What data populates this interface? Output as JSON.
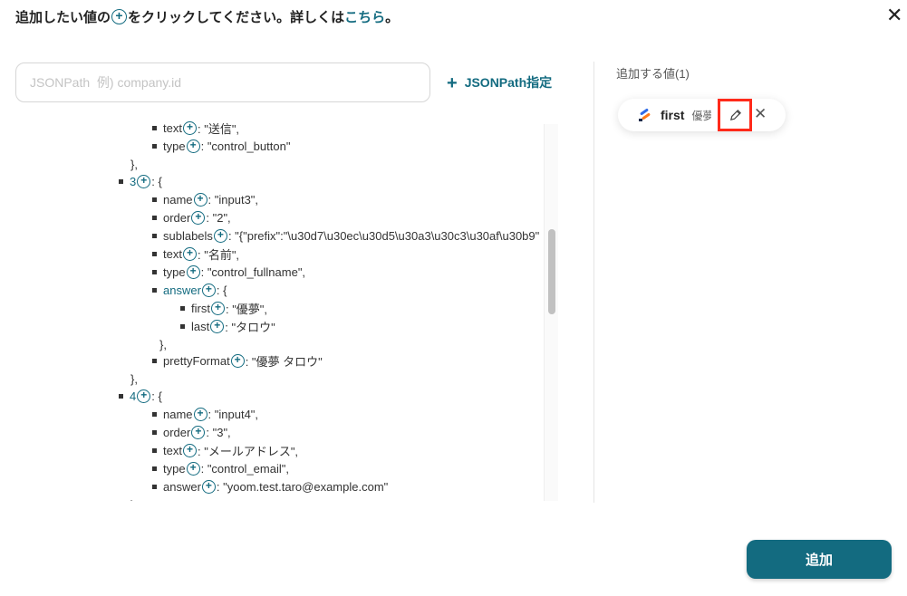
{
  "header": {
    "title_before": "追加したい値の",
    "title_after": "をクリックしてください。詳しくは",
    "link": "こちら",
    "title_end": "。",
    "close_icon": "close-icon"
  },
  "search": {
    "placeholder": "JSONPath  例) company.id",
    "value": ""
  },
  "jsonpath_button": "JSONPath指定",
  "tree": [
    {
      "level": 2,
      "key": "text",
      "value": "\"送信\","
    },
    {
      "level": 2,
      "key": "type",
      "value": "\"control_button\""
    },
    {
      "level": 1,
      "close": "},"
    },
    {
      "level": 1,
      "key": "3",
      "value": "{",
      "blue": true
    },
    {
      "level": 2,
      "key": "name",
      "value": "\"input3\","
    },
    {
      "level": 2,
      "key": "order",
      "value": "\"2\","
    },
    {
      "level": 2,
      "key": "sublabels",
      "value": "\"{\"prefix\":\"\\u30d7\\u30ec\\u30d5\\u30a3\\u30c3\\u30af\\u30b9\""
    },
    {
      "level": 2,
      "key": "text",
      "value": "\"名前\","
    },
    {
      "level": 2,
      "key": "type",
      "value": "\"control_fullname\","
    },
    {
      "level": 2,
      "key": "answer",
      "value": "{",
      "blue": true
    },
    {
      "level": 3,
      "key": "first",
      "value": "\"優夢\","
    },
    {
      "level": 3,
      "key": "last",
      "value": "\"タロウ\""
    },
    {
      "level": 2,
      "close": "},"
    },
    {
      "level": 2,
      "key": "prettyFormat",
      "value": "\"優夢 タロウ\""
    },
    {
      "level": 1,
      "close": "},"
    },
    {
      "level": 1,
      "key": "4",
      "value": "{",
      "blue": true
    },
    {
      "level": 2,
      "key": "name",
      "value": "\"input4\","
    },
    {
      "level": 2,
      "key": "order",
      "value": "\"3\","
    },
    {
      "level": 2,
      "key": "text",
      "value": "\"メールアドレス\","
    },
    {
      "level": 2,
      "key": "type",
      "value": "\"control_email\","
    },
    {
      "level": 2,
      "key": "answer",
      "value": "\"yoom.test.taro@example.com\""
    },
    {
      "level": 1,
      "close": "},"
    }
  ],
  "right": {
    "heading": "追加する値(1)",
    "chip": {
      "name": "first",
      "value": "優夢",
      "edit_icon": "pencil-icon",
      "remove_icon": "close-icon"
    }
  },
  "add_button": "追加",
  "colors": {
    "accent": "#136b80",
    "highlight": "#ff2a1a"
  }
}
